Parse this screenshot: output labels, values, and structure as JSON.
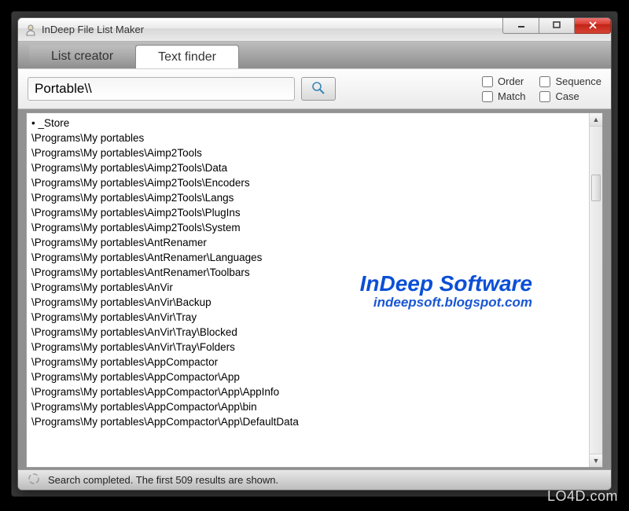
{
  "window": {
    "title": "InDeep File List Maker"
  },
  "tabs": {
    "list_creator": "List creator",
    "text_finder": "Text finder",
    "active": "text_finder"
  },
  "search": {
    "value": "Portable\\\\"
  },
  "options": {
    "order": {
      "label": "Order",
      "checked": false
    },
    "sequence": {
      "label": "Sequence",
      "checked": false
    },
    "match": {
      "label": "Match",
      "checked": false
    },
    "case": {
      "label": "Case",
      "checked": false
    }
  },
  "results": [
    "• _Store",
    "\\Programs\\My portables",
    "\\Programs\\My portables\\Aimp2Tools",
    "\\Programs\\My portables\\Aimp2Tools\\Data",
    "\\Programs\\My portables\\Aimp2Tools\\Encoders",
    "\\Programs\\My portables\\Aimp2Tools\\Langs",
    "\\Programs\\My portables\\Aimp2Tools\\PlugIns",
    "\\Programs\\My portables\\Aimp2Tools\\System",
    "\\Programs\\My portables\\AntRenamer",
    "\\Programs\\My portables\\AntRenamer\\Languages",
    "\\Programs\\My portables\\AntRenamer\\Toolbars",
    "\\Programs\\My portables\\AnVir",
    "\\Programs\\My portables\\AnVir\\Backup",
    "\\Programs\\My portables\\AnVir\\Tray",
    "\\Programs\\My portables\\AnVir\\Tray\\Blocked",
    "\\Programs\\My portables\\AnVir\\Tray\\Folders",
    "\\Programs\\My portables\\AppCompactor",
    "\\Programs\\My portables\\AppCompactor\\App",
    "\\Programs\\My portables\\AppCompactor\\App\\AppInfo",
    "\\Programs\\My portables\\AppCompactor\\App\\bin",
    "\\Programs\\My portables\\AppCompactor\\App\\DefaultData"
  ],
  "status": {
    "text": "Search completed. The first 509 results are shown."
  },
  "watermark": {
    "title": "InDeep Software",
    "url": "indeepsoft.blogspot.com"
  },
  "site_watermark": "LO4D.com"
}
